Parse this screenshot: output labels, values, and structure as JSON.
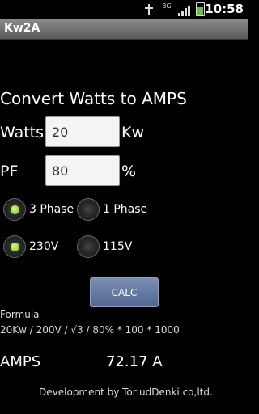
{
  "status_bar": {
    "time": "10:58",
    "network": "3G"
  },
  "app": {
    "title": "Kw2A"
  },
  "heading": "Convert Watts to AMPS",
  "watts": {
    "label": "Watts",
    "value": "20",
    "unit": "Kw"
  },
  "pf": {
    "label": "PF",
    "value": "80",
    "unit": "%"
  },
  "phase": {
    "options": [
      "3 Phase",
      "1 Phase"
    ],
    "selected": "3 Phase"
  },
  "voltage": {
    "options": [
      "230V",
      "115V"
    ],
    "selected": "230V"
  },
  "calc_button": "CALC",
  "formula": {
    "label": "Formula",
    "text": "20Kw / 200V / √3 / 80% * 100 * 1000"
  },
  "result": {
    "label": "AMPS",
    "value": "72.17 A"
  },
  "footer": "Development by ToriudDenki co,ltd.",
  "colors": {
    "background": "#000000",
    "selected_radio": "#8fd63a",
    "button": "#61759c"
  }
}
